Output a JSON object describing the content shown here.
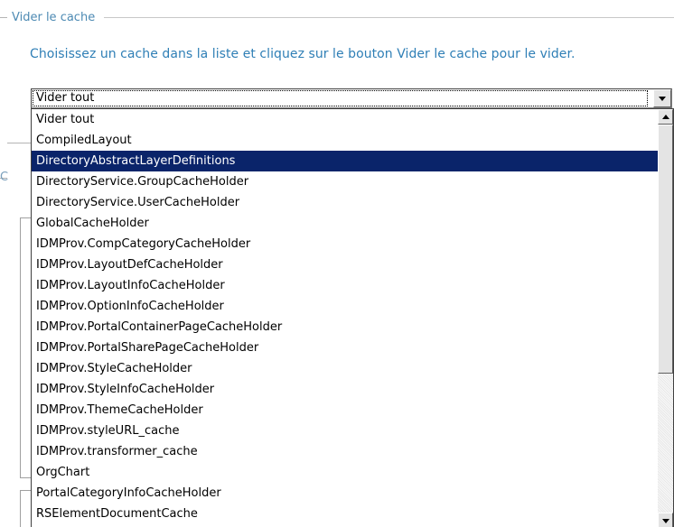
{
  "section": {
    "legend": "Vider le cache",
    "instructions": "Choisissez un cache dans la liste et cliquez sur le bouton Vider le cache pour le vider."
  },
  "background": {
    "partial_letter": "C"
  },
  "cache_select": {
    "selected_value": "Vider tout",
    "highlighted_index": 2,
    "options": [
      "Vider tout",
      "CompiledLayout",
      "DirectoryAbstractLayerDefinitions",
      "DirectoryService.GroupCacheHolder",
      "DirectoryService.UserCacheHolder",
      "GlobalCacheHolder",
      "IDMProv.CompCategoryCacheHolder",
      "IDMProv.LayoutDefCacheHolder",
      "IDMProv.LayoutInfoCacheHolder",
      "IDMProv.OptionInfoCacheHolder",
      "IDMProv.PortalContainerPageCacheHolder",
      "IDMProv.PortalSharePageCacheHolder",
      "IDMProv.StyleCacheHolder",
      "IDMProv.StyleInfoCacheHolder",
      "IDMProv.ThemeCacheHolder",
      "IDMProv.styleURL_cache",
      "IDMProv.transformer_cache",
      "OrgChart",
      "PortalCategoryInfoCacheHolder",
      "RSElementDocumentCache"
    ]
  },
  "colors": {
    "legend": "#4d8ab3",
    "instructions": "#2f7fb6",
    "selection": "#0a246a"
  },
  "icons": {
    "dropdown_arrow": "chevron-down-icon",
    "scroll_up": "arrow-up-icon",
    "scroll_down": "arrow-down-icon"
  }
}
